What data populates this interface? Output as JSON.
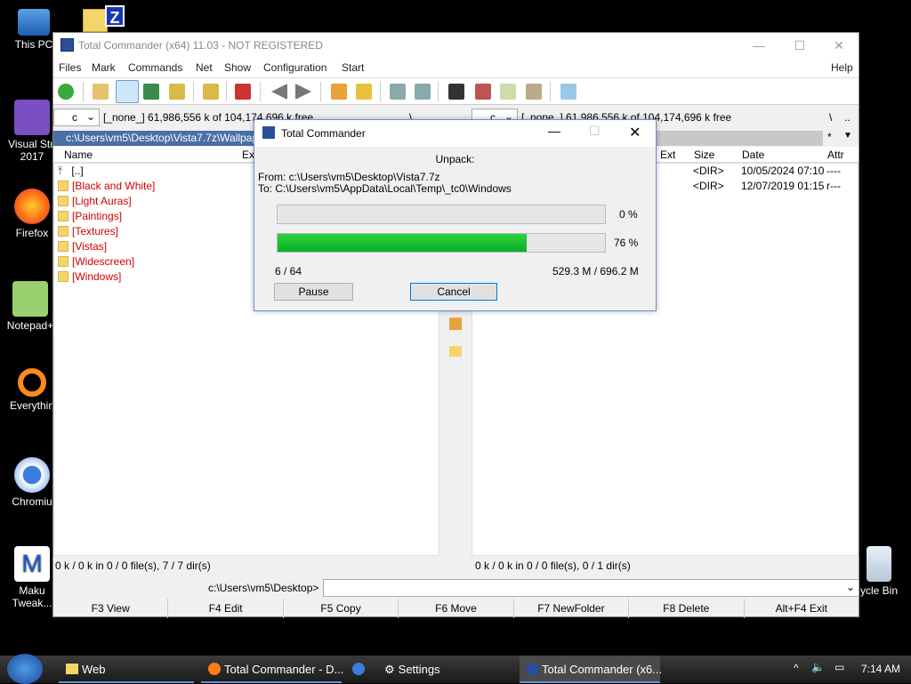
{
  "desktop": {
    "icons": [
      {
        "label": "This PC"
      },
      {
        "label": "Visual Stu\n2017"
      },
      {
        "label": "Firefox"
      },
      {
        "label": "Notepad+"
      },
      {
        "label": "Everythin"
      },
      {
        "label": "Chromiu"
      },
      {
        "label": "Maku\nTweak..."
      },
      {
        "label": "ycle Bin"
      }
    ]
  },
  "window": {
    "title": "Total Commander (x64) 11.03 - NOT REGISTERED",
    "menu": [
      "Files",
      "Mark",
      "Commands",
      "Net",
      "Show",
      "Configuration",
      "Start",
      "Help"
    ],
    "left": {
      "drive": "c",
      "free": "[_none_]  61,986,556 k of 104,174,696 k free",
      "path": "c:\\Users\\vm5\\Desktop\\Vista7.7z\\Wallpap",
      "headers": {
        "name": "Name",
        "ext": "Ext"
      },
      "items": [
        "[..]",
        "[Black and White]",
        "[Light Auras]",
        "[Paintings]",
        "[Textures]",
        "[Vistas]",
        "[Widescreen]",
        "[Windows]"
      ],
      "status": "0 k / 0 k in 0 / 0 file(s), 7 / 7 dir(s)"
    },
    "right": {
      "drive": "c",
      "free": "[_none_]  61,986,556 k of 104,174,696 k free",
      "headers": {
        "ext": "Ext",
        "size": "Size",
        "date": "Date",
        "attr": "Attr"
      },
      "rows": [
        {
          "size": "<DIR>",
          "date": "10/05/2024 07:10",
          "attr": "----"
        },
        {
          "size": "<DIR>",
          "date": "12/07/2019 01:15",
          "attr": "r---"
        }
      ],
      "status": "0 k / 0 k in 0 / 0 file(s), 0 / 1 dir(s)"
    },
    "cmd_prompt": "c:\\Users\\vm5\\Desktop>",
    "fkeys": [
      "F3 View",
      "F4 Edit",
      "F5 Copy",
      "F6 Move",
      "F7 NewFolder",
      "F8 Delete",
      "Alt+F4 Exit"
    ]
  },
  "dialog": {
    "title": "Total Commander",
    "heading": "Unpack:",
    "from": "From: c:\\Users\\vm5\\Desktop\\Vista7.7z",
    "to": "To:  C:\\Users\\vm5\\AppData\\Local\\Temp\\_tc0\\Windows",
    "progress1": {
      "label": "0 %",
      "value": 0
    },
    "progress2": {
      "label": "76 %",
      "value": 0.76
    },
    "count": "6 / 64",
    "size": "529.3 M / 696.2 M",
    "pause": "Pause",
    "cancel": "Cancel"
  },
  "taskbar": {
    "items": [
      "Web",
      "Total Commander - D...",
      "Settings",
      "Total Commander (x6..."
    ],
    "time": "7:14 AM"
  }
}
